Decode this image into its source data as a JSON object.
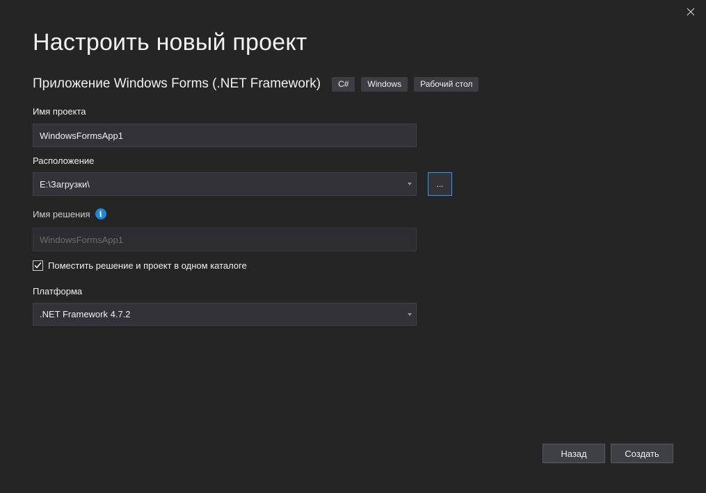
{
  "dialog": {
    "title": "Настроить новый проект"
  },
  "template": {
    "name": "Приложение Windows Forms (.NET Framework)",
    "tags": [
      "C#",
      "Windows",
      "Рабочий стол"
    ]
  },
  "project_name": {
    "label": "Имя проекта",
    "value": "WindowsFormsApp1"
  },
  "location": {
    "label": "Расположение",
    "value": "E:\\Загрузки\\",
    "browse_label": "..."
  },
  "solution_name": {
    "label": "Имя решения",
    "placeholder": "WindowsFormsApp1",
    "info_icon": "info-icon"
  },
  "same_directory": {
    "label": "Поместить решение и проект в одном каталоге",
    "checked": true
  },
  "framework": {
    "label": "Платформа",
    "value": ".NET Framework 4.7.2"
  },
  "buttons": {
    "back_label": "Назад",
    "create_label": "Создать"
  },
  "colors": {
    "background": "#252526",
    "input_background": "#333337",
    "accent_blue": "#3399ff",
    "info_blue": "#1e88d8"
  }
}
